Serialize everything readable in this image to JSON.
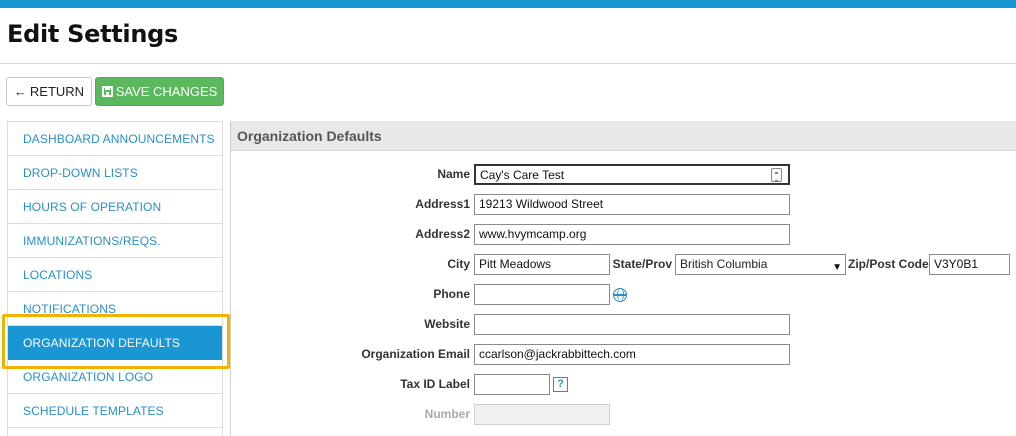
{
  "colors": {
    "accent": "#1a96d4",
    "save_green": "#5cb85c",
    "highlight": "#f0b400",
    "link": "#2a8fc7"
  },
  "page": {
    "title": "Edit Settings"
  },
  "toolbar": {
    "return_label": "RETURN",
    "save_label": "SAVE CHANGES",
    "return_icon": "arrow-left-icon",
    "save_icon": "floppy-disk-icon"
  },
  "sidebar": {
    "items": [
      {
        "label": "DASHBOARD ANNOUNCEMENTS"
      },
      {
        "label": "DROP-DOWN LISTS"
      },
      {
        "label": "HOURS OF OPERATION"
      },
      {
        "label": "IMMUNIZATIONS/REQS."
      },
      {
        "label": "LOCATIONS"
      },
      {
        "label": "NOTIFICATIONS"
      },
      {
        "label": "ORGANIZATION DEFAULTS",
        "active": true
      },
      {
        "label": "ORGANIZATION LOGO"
      },
      {
        "label": "SCHEDULE TEMPLATES"
      }
    ]
  },
  "panel": {
    "header": "Organization Defaults",
    "fields": {
      "name": {
        "label": "Name",
        "value": "Cay's Care Test"
      },
      "address1": {
        "label": "Address1",
        "value": "19213 Wildwood Street"
      },
      "address2": {
        "label": "Address2",
        "value": "www.hvymcamp.org"
      },
      "city": {
        "label": "City",
        "value": "Pitt Meadows"
      },
      "state": {
        "label": "State/Prov",
        "value": "British Columbia"
      },
      "zip": {
        "label": "Zip/Post Code",
        "value": "V3Y0B1"
      },
      "phone": {
        "label": "Phone",
        "value": ""
      },
      "website": {
        "label": "Website",
        "value": ""
      },
      "email": {
        "label": "Organization Email",
        "value": "ccarlson@jackrabbittech.com"
      },
      "tax_id": {
        "label": "Tax ID Label",
        "value": "",
        "help_icon_text": "?"
      },
      "number": {
        "label": "Number",
        "value": ""
      }
    }
  }
}
